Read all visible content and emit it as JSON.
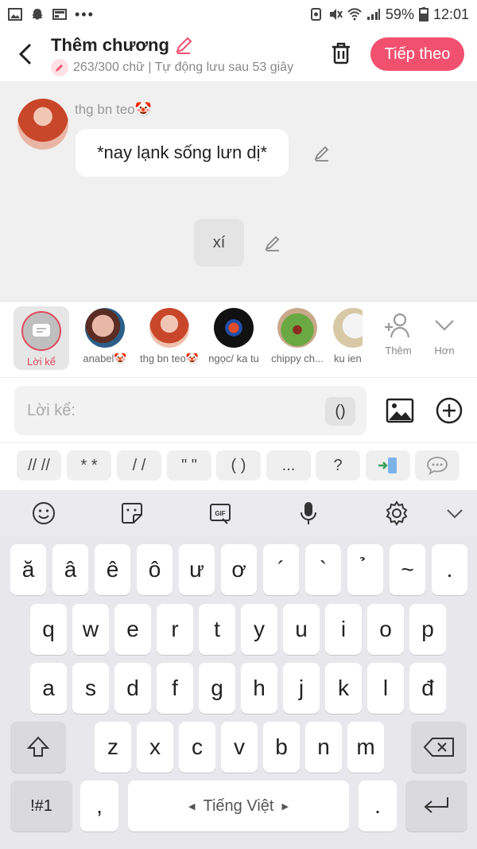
{
  "status_bar": {
    "battery": "59%",
    "time": "12:01"
  },
  "header": {
    "title": "Thêm chương",
    "subtitle": "263/300 chữ | Tự động lưu sau 53 giây",
    "next_label": "Tiếp theo"
  },
  "chat": {
    "sender_name": "thg bn teo🤡",
    "message": "*nay lạnk sống lưn dị*",
    "narration": "xí"
  },
  "characters": [
    {
      "label": "Lời kể",
      "selected": true
    },
    {
      "label": "anabel🤡"
    },
    {
      "label": "thg bn teo🤡"
    },
    {
      "label": "ngọc/ ka tu"
    },
    {
      "label": "chippy ch..."
    },
    {
      "label": "ku ien"
    }
  ],
  "tools": {
    "add_label": "Thêm",
    "more_label": "Hơn"
  },
  "input": {
    "placeholder": "Lời kể:",
    "paren_button": "()"
  },
  "format_buttons": [
    "// //",
    "* *",
    "/ /",
    "\" \"",
    "( )",
    "...",
    "?"
  ],
  "keyboard": {
    "row1": [
      "ă",
      "â",
      "ê",
      "ô",
      "ư",
      "ơ",
      "´",
      "`",
      "̉",
      "~",
      "."
    ],
    "row2": [
      "q",
      "w",
      "e",
      "r",
      "t",
      "y",
      "u",
      "i",
      "o",
      "p"
    ],
    "row3": [
      "a",
      "s",
      "d",
      "f",
      "g",
      "h",
      "j",
      "k",
      "l",
      "đ"
    ],
    "row4": [
      "z",
      "x",
      "c",
      "v",
      "b",
      "n",
      "m"
    ],
    "symbols_key": "!#1",
    "comma_key": ",",
    "space_label": "Tiếng Việt",
    "period_key": "."
  },
  "colors": {
    "accent": "#f2506f"
  }
}
